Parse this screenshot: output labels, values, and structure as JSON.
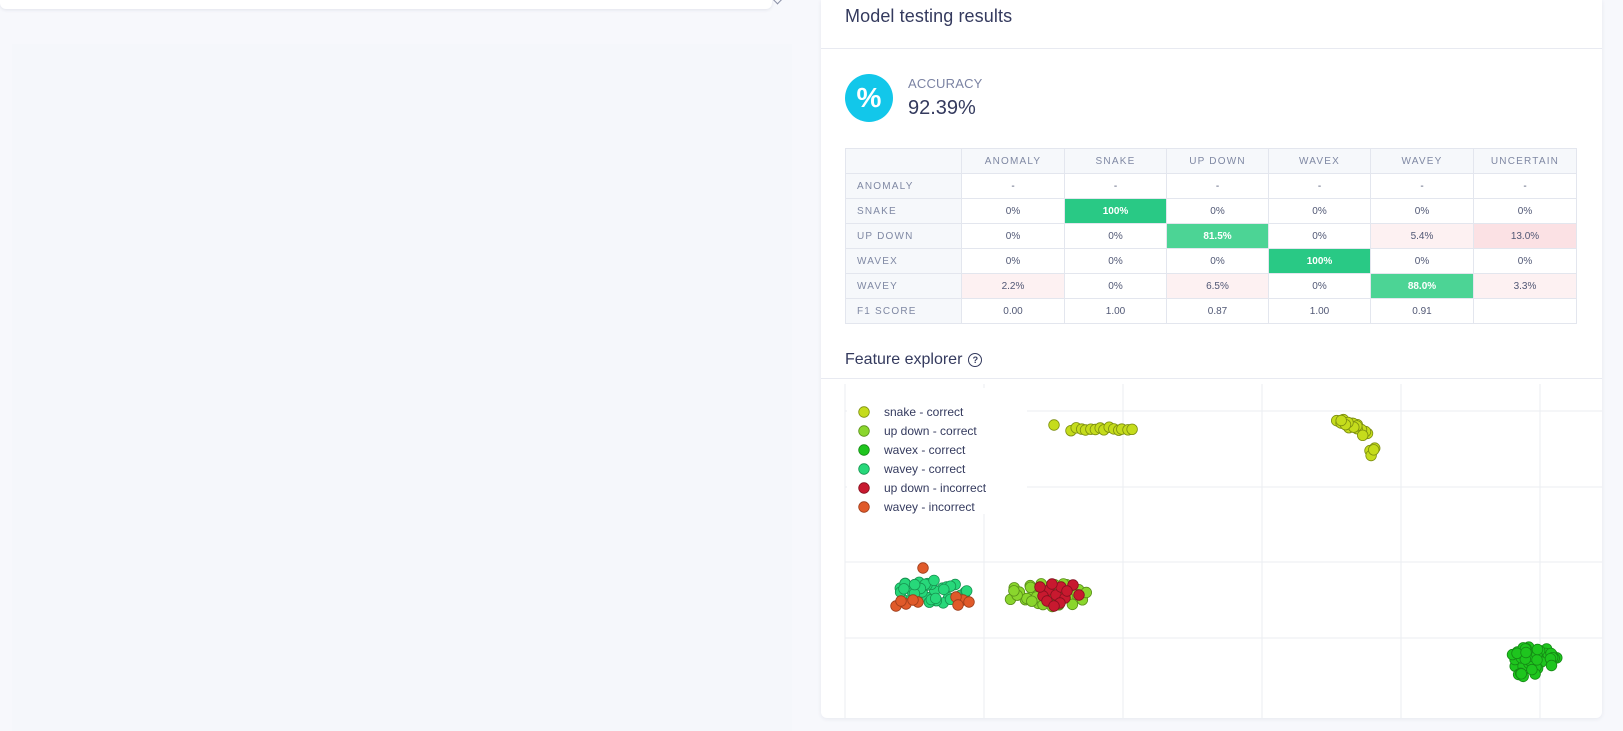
{
  "results": {
    "title": "Model testing results",
    "accuracy_label": "ACCURACY",
    "accuracy_value": "92.39%",
    "accuracy_icon": "percent-icon",
    "accuracy_icon_color": "#12c7ea"
  },
  "confusion_matrix": {
    "columns": [
      "ANOMALY",
      "SNAKE",
      "UP DOWN",
      "WAVEX",
      "WAVEY",
      "UNCERTAIN"
    ],
    "rows": [
      {
        "label": "ANOMALY",
        "cells": [
          "-",
          "-",
          "-",
          "-",
          "-",
          "-"
        ]
      },
      {
        "label": "SNAKE",
        "cells": [
          "0%",
          "100%",
          "0%",
          "0%",
          "0%",
          "0%"
        ]
      },
      {
        "label": "UP DOWN",
        "cells": [
          "0%",
          "0%",
          "81.5%",
          "0%",
          "5.4%",
          "13.0%"
        ]
      },
      {
        "label": "WAVEX",
        "cells": [
          "0%",
          "0%",
          "0%",
          "100%",
          "0%",
          "0%"
        ]
      },
      {
        "label": "WAVEY",
        "cells": [
          "2.2%",
          "0%",
          "6.5%",
          "0%",
          "88.0%",
          "3.3%"
        ]
      },
      {
        "label": "F1 SCORE",
        "cells": [
          "0.00",
          "1.00",
          "0.87",
          "1.00",
          "0.91",
          ""
        ]
      }
    ],
    "highlight_color": "#29c985",
    "error_color": "#fbe1e4"
  },
  "feature_explorer": {
    "title": "Feature explorer",
    "help_icon": "question-circle-icon",
    "legend": [
      {
        "name": "snake - correct",
        "color": "#c5dc1c",
        "stroke": "#7d8f10"
      },
      {
        "name": "up down - correct",
        "color": "#8ad62d",
        "stroke": "#5a8f1a"
      },
      {
        "name": "wavex - correct",
        "color": "#1ec51e",
        "stroke": "#158a15"
      },
      {
        "name": "wavey - correct",
        "color": "#27d87a",
        "stroke": "#179451"
      },
      {
        "name": "up down - incorrect",
        "color": "#c8192f",
        "stroke": "#85101f"
      },
      {
        "name": "wavey - incorrect",
        "color": "#e05a2a",
        "stroke": "#9c3c1a"
      }
    ]
  }
}
